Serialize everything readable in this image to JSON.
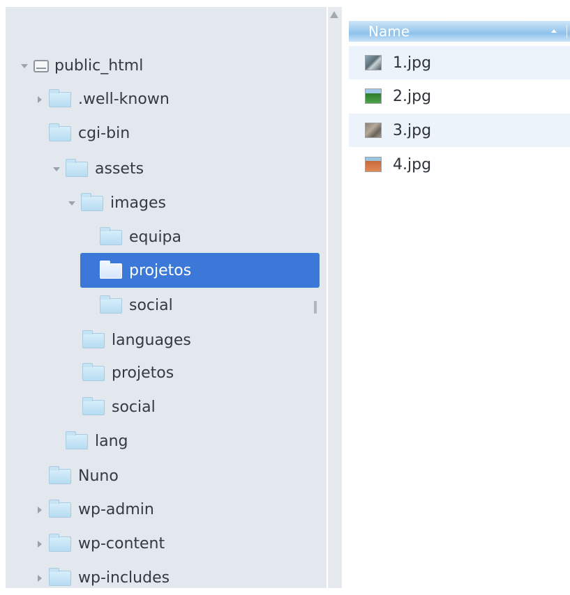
{
  "tree": {
    "items": [
      {
        "label": "public_html",
        "icon": "drive-icon",
        "arrow": "down",
        "selected": false
      },
      {
        "label": ".well-known",
        "icon": "folder-icon",
        "arrow": "right",
        "selected": false
      },
      {
        "label": "cgi-bin",
        "icon": "folder-icon",
        "arrow": "none",
        "selected": false
      },
      {
        "label": "assets",
        "icon": "folder-icon",
        "arrow": "down",
        "selected": false
      },
      {
        "label": "images",
        "icon": "folder-icon",
        "arrow": "down",
        "selected": false
      },
      {
        "label": "equipa",
        "icon": "folder-icon",
        "arrow": "none",
        "selected": false
      },
      {
        "label": "projetos",
        "icon": "folder-open-icon",
        "arrow": "none",
        "selected": true
      },
      {
        "label": "social",
        "icon": "folder-icon",
        "arrow": "none",
        "selected": false
      },
      {
        "label": "languages",
        "icon": "folder-icon",
        "arrow": "none",
        "selected": false
      },
      {
        "label": "projetos",
        "icon": "folder-icon",
        "arrow": "none",
        "selected": false
      },
      {
        "label": "social",
        "icon": "folder-icon",
        "arrow": "none",
        "selected": false
      },
      {
        "label": "lang",
        "icon": "folder-icon",
        "arrow": "none",
        "selected": false
      },
      {
        "label": "Nuno",
        "icon": "folder-icon",
        "arrow": "none",
        "selected": false
      },
      {
        "label": "wp-admin",
        "icon": "folder-icon",
        "arrow": "right",
        "selected": false
      },
      {
        "label": "wp-content",
        "icon": "folder-icon",
        "arrow": "right",
        "selected": false
      },
      {
        "label": "wp-includes",
        "icon": "folder-icon",
        "arrow": "right",
        "selected": false
      }
    ]
  },
  "file_list": {
    "header": {
      "name_label": "Name",
      "sort": "ascending"
    },
    "files": [
      {
        "name": "1.jpg",
        "icon": "image-thumbnail-icon"
      },
      {
        "name": "2.jpg",
        "icon": "image-thumbnail-icon"
      },
      {
        "name": "3.jpg",
        "icon": "image-thumbnail-icon"
      },
      {
        "name": "4.jpg",
        "icon": "image-thumbnail-icon"
      }
    ]
  },
  "colors": {
    "selection": "#3c78d8",
    "tree_background": "#e2e8ed",
    "header_gradient": "#8ec2ec",
    "alt_row": "#edf3fb"
  }
}
